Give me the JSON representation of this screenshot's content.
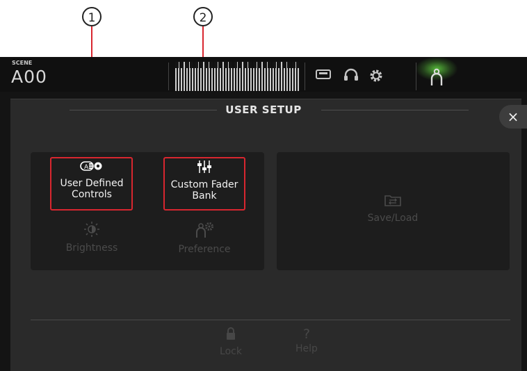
{
  "callouts": [
    {
      "number": "1"
    },
    {
      "number": "2"
    }
  ],
  "header": {
    "scene_label": "SCENE",
    "scene_number": "A00"
  },
  "toolbar": {
    "icons": [
      "recorder-icon",
      "headphones-icon",
      "settings-gear-icon",
      "user-icon"
    ]
  },
  "panel": {
    "title": "USER SETUP",
    "close_label": "×",
    "tiles": {
      "user_defined_controls": {
        "label_line1": "User Defined",
        "label_line2": "Controls"
      },
      "custom_fader_bank": {
        "label_line1": "Custom Fader",
        "label_line2": "Bank"
      },
      "brightness": {
        "label": "Brightness"
      },
      "preference": {
        "label": "Preference"
      },
      "save_load": {
        "label": "Save/Load"
      }
    },
    "bottom": {
      "lock": {
        "label": "Lock"
      },
      "help": {
        "label": "Help",
        "icon": "?"
      }
    }
  },
  "colors": {
    "highlight": "#d8262f",
    "active_user_glow": "#60d240",
    "panel_bg": "#2a2a2a",
    "screen_bg": "#141414"
  }
}
